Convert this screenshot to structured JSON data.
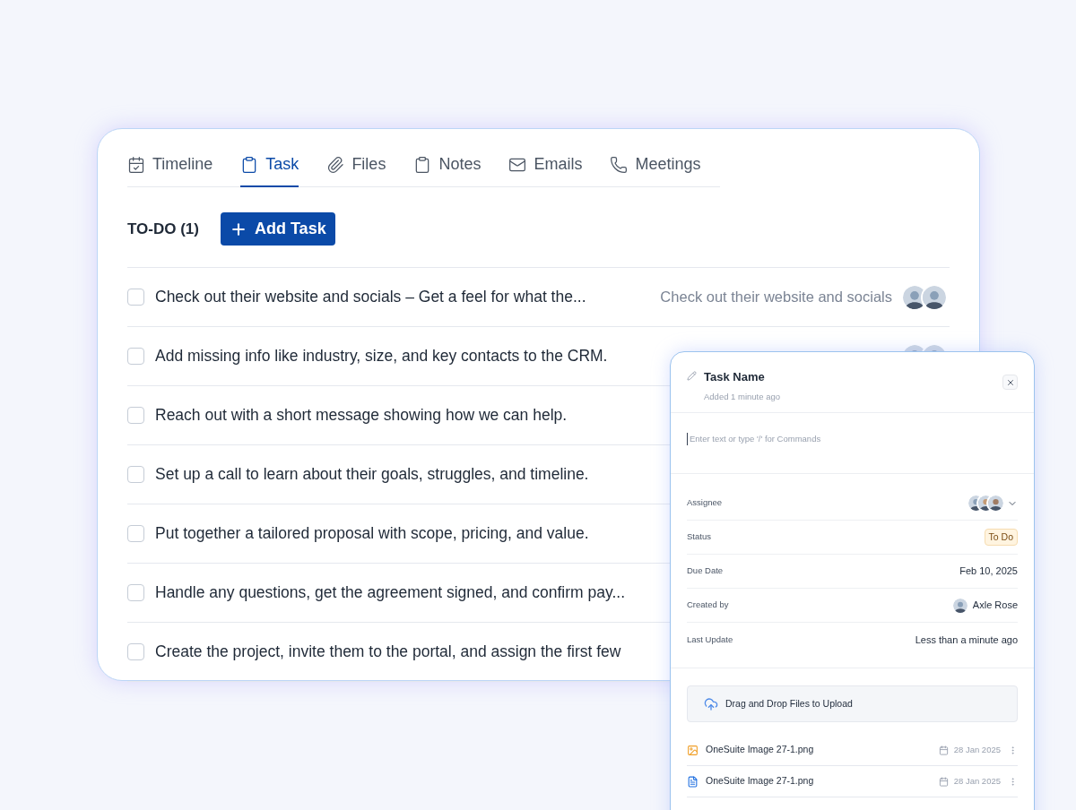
{
  "tabs": [
    {
      "label": "Timeline",
      "kind": "timeline",
      "selected": false
    },
    {
      "label": "Task",
      "kind": "task",
      "selected": true
    },
    {
      "label": "Files",
      "kind": "files",
      "selected": false
    },
    {
      "label": "Notes",
      "kind": "notes",
      "selected": false
    },
    {
      "label": "Emails",
      "kind": "emails",
      "selected": false
    },
    {
      "label": "Meetings",
      "kind": "meetings",
      "selected": false
    }
  ],
  "section": {
    "title": "TO-DO (1)",
    "add_button": "Add Task"
  },
  "tasks": [
    {
      "text": "Check out their website and socials – Get a feel for what the...",
      "checked": false,
      "note": "Check out their website and socials",
      "has_avatars": true
    },
    {
      "text": "Add missing info like industry, size, and key contacts to the CRM.",
      "checked": false,
      "has_avatars": true
    },
    {
      "text": "Reach out with a short message showing how we can help.",
      "checked": false
    },
    {
      "text": "Set up a call to learn about their goals, struggles, and timeline.",
      "checked": false
    },
    {
      "text": "Put together a tailored proposal with scope, pricing, and value.",
      "checked": false
    },
    {
      "text": "Handle any questions, get the agreement signed, and confirm pay...",
      "checked": false
    },
    {
      "text": "Create the project, invite them to the portal, and assign the first few",
      "checked": false
    }
  ],
  "panel": {
    "title": "Task Name",
    "subtitle": "Added 1 minute ago",
    "editor_placeholder": "Enter text or type '/' for Commands",
    "properties": [
      {
        "label": "Assignee",
        "kind": "avatars"
      },
      {
        "label": "Status",
        "kind": "badge",
        "value": "To Do"
      },
      {
        "label": "Due Date",
        "kind": "text",
        "value": "Feb 10, 2025"
      },
      {
        "label": "Created by",
        "kind": "person",
        "value": "Axle Rose"
      },
      {
        "label": "Last Update",
        "kind": "text",
        "value": "Less than a minute ago"
      }
    ],
    "upload": "Drag and Drop Files to Upload",
    "files": [
      {
        "name": "OneSuite Image 27-1.png",
        "kind": "image",
        "date": "28 Jan 2025"
      },
      {
        "name": "OneSuite Image 27-1.png",
        "kind": "doc",
        "date": "28 Jan 2025"
      }
    ]
  }
}
